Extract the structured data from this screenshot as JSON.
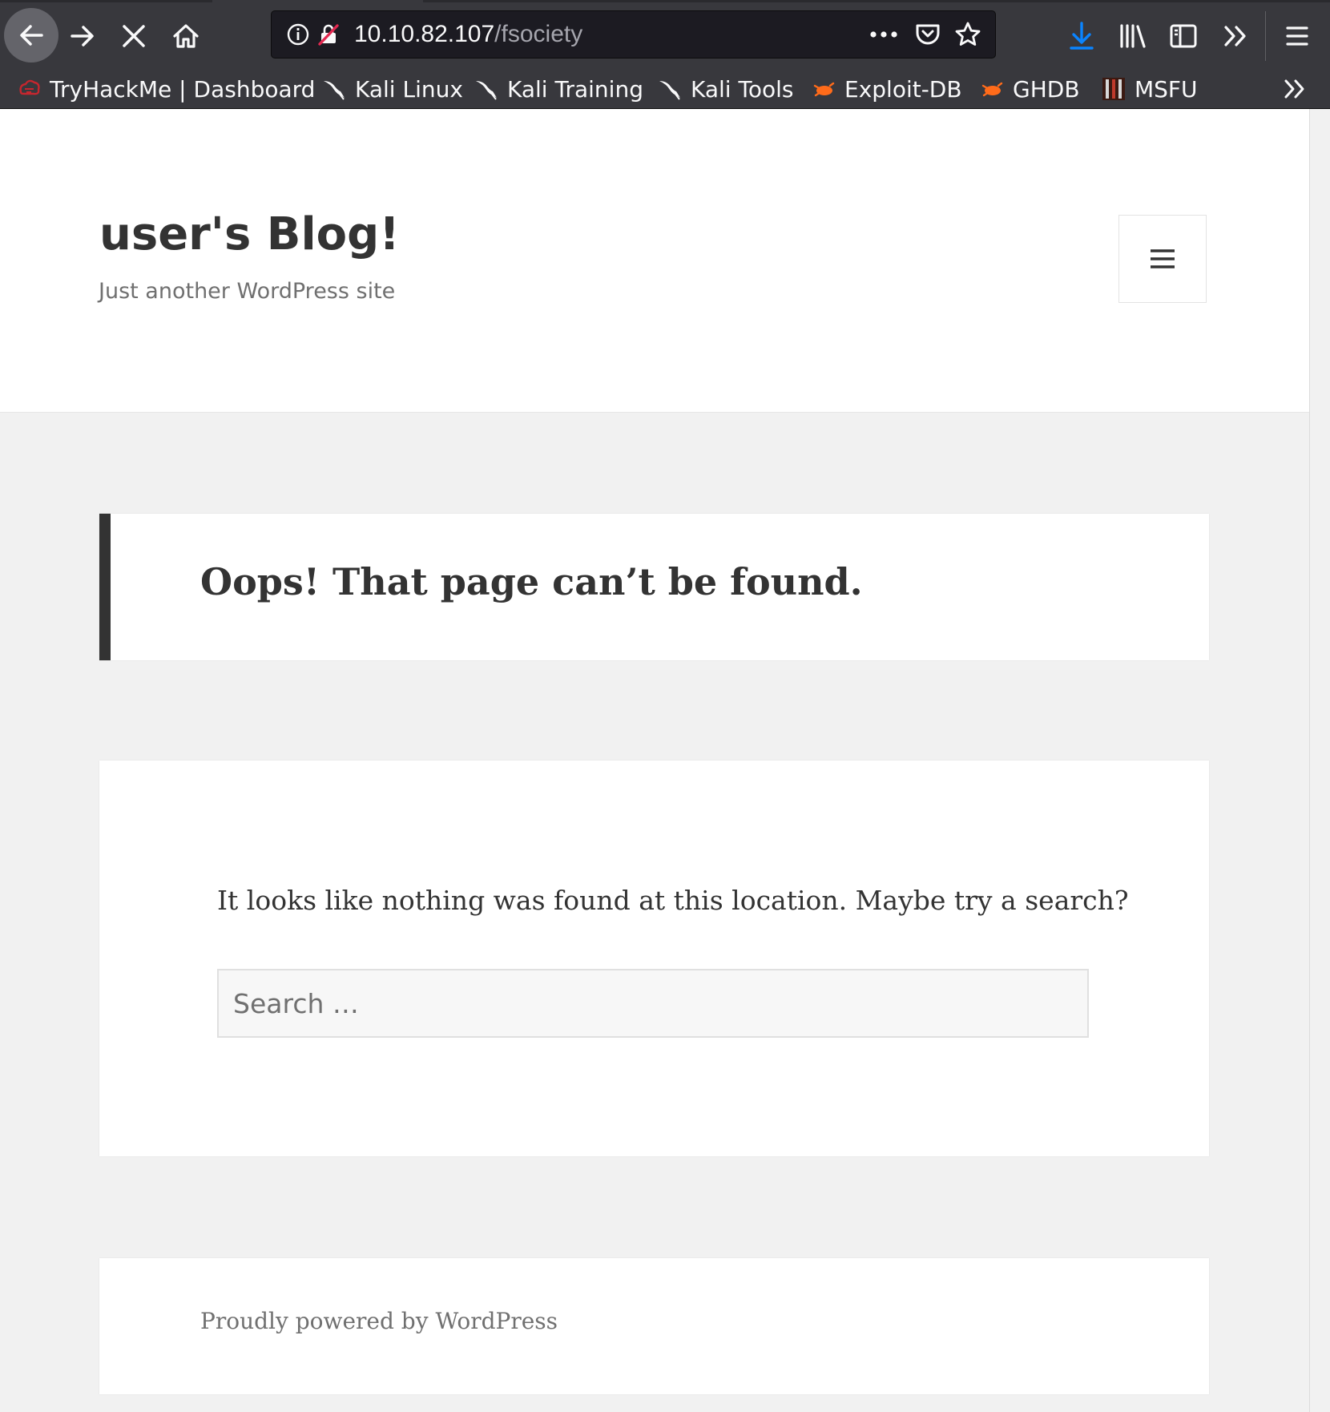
{
  "browser": {
    "url_host": "10.10.82.107",
    "url_path": "/fsociety",
    "accent": "#0a84ff",
    "bookmarks": [
      {
        "label": "TryHackMe | Dashboard",
        "icon": "tryhackme-icon"
      },
      {
        "label": "Kali Linux",
        "icon": "kali-dragon-icon"
      },
      {
        "label": "Kali Training",
        "icon": "kali-dragon-icon"
      },
      {
        "label": "Kali Tools",
        "icon": "kali-dragon-icon"
      },
      {
        "label": "Exploit-DB",
        "icon": "exploit-db-icon"
      },
      {
        "label": "GHDB",
        "icon": "exploit-db-icon"
      },
      {
        "label": "MSFU",
        "icon": "msfu-icon"
      }
    ]
  },
  "site": {
    "title": "user's Blog!",
    "description": "Just another WordPress site"
  },
  "not_found": {
    "heading": "Oops! That page can’t be found.",
    "message": "It looks like nothing was found at this location. Maybe try a search?",
    "search_placeholder": "Search …"
  },
  "footer": {
    "credit": "Proudly powered by WordPress"
  }
}
